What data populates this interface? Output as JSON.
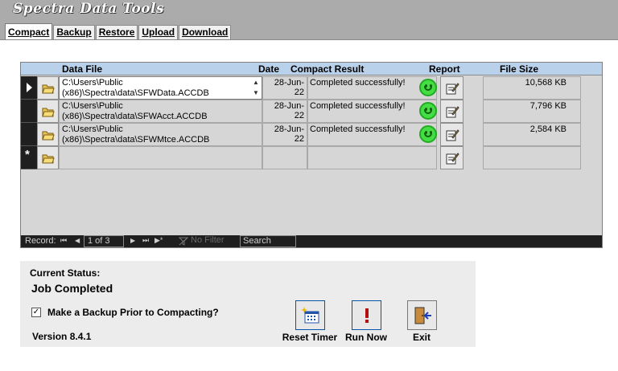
{
  "app": {
    "title": "Spectra Data Tools"
  },
  "tabs": [
    {
      "label": "Compact",
      "active": true
    },
    {
      "label": "Backup",
      "active": false
    },
    {
      "label": "Restore",
      "active": false
    },
    {
      "label": "Upload",
      "active": false
    },
    {
      "label": "Download",
      "active": false
    }
  ],
  "grid": {
    "headers": {
      "data_file": "Data File",
      "date": "Date",
      "compact_result": "Compact Result",
      "report": "Report",
      "file_size": "File Size"
    },
    "rows": [
      {
        "file": "C:\\Users\\Public (x86)\\Spectra\\data\\SFWData.ACCDB",
        "date": "28-Jun-22",
        "result": "Completed successfully!",
        "size": "10,568 KB",
        "current": true
      },
      {
        "file": "C:\\Users\\Public (x86)\\Spectra\\data\\SFWAcct.ACCDB",
        "date": "28-Jun-22",
        "result": "Completed successfully!",
        "size": "7,796 KB",
        "current": false
      },
      {
        "file": "C:\\Users\\Public (x86)\\Spectra\\data\\SFWMtce.ACCDB",
        "date": "28-Jun-22",
        "result": "Completed successfully!",
        "size": "2,584 KB",
        "current": false
      }
    ],
    "new_row_marker": "*",
    "navigation": {
      "record_label": "Record:",
      "position": "1 of 3",
      "filter": "No Filter",
      "search": "Search",
      "first": "⏮",
      "prev": "◀",
      "next": "▶",
      "last": "⏭",
      "new": "▶*"
    }
  },
  "panel": {
    "status_label": "Current Status:",
    "status_value": "Job Completed",
    "backup_checkbox": {
      "label": "Make a Backup Prior to Compacting?",
      "checked": true,
      "mark": "✓"
    },
    "version": "Version 8.4.1",
    "buttons": {
      "reset_timer": "Reset Timer",
      "run_now": "Run Now",
      "exit": "Exit"
    }
  },
  "colors": {
    "header_bg": "#b9d1ea",
    "nav_bg": "#1f1f1f",
    "success": "#44dd44",
    "accent": "#0055aa"
  }
}
